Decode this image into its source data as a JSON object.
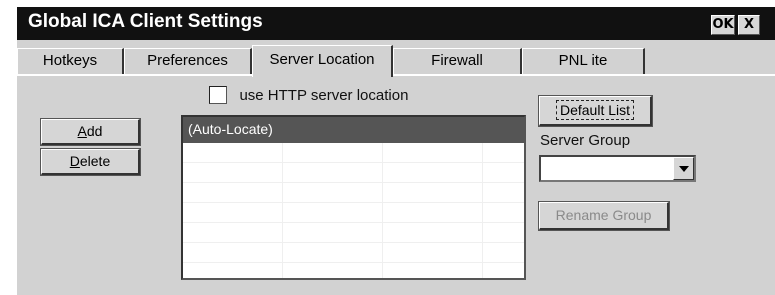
{
  "window": {
    "title": "Global ICA Client Settings",
    "ok_label": "OK",
    "close_label": "X"
  },
  "tabs": [
    {
      "label": "Hotkeys",
      "active": false
    },
    {
      "label": "Preferences",
      "active": false
    },
    {
      "label": "Server Location",
      "active": true
    },
    {
      "label": "Firewall",
      "active": false
    },
    {
      "label": "PNL ite",
      "active": false
    }
  ],
  "server_location": {
    "http_checkbox": {
      "label": "use HTTP server location",
      "checked": false
    },
    "add_button": {
      "first": "A",
      "rest": "dd"
    },
    "delete_button": {
      "first": "D",
      "rest": "elete"
    },
    "server_list": {
      "items": [
        "(Auto-Locate)"
      ],
      "selected_index": 0
    },
    "default_list_button": "Default List",
    "server_group": {
      "label": "Server Group",
      "value": ""
    },
    "rename_group_button": {
      "label": "Rename Group",
      "enabled": false
    }
  },
  "colors": {
    "titlebar": "#111111",
    "dialog_bg": "#d2d2d2",
    "selection": "#555555",
    "disabled_text": "#8a8a8a"
  }
}
